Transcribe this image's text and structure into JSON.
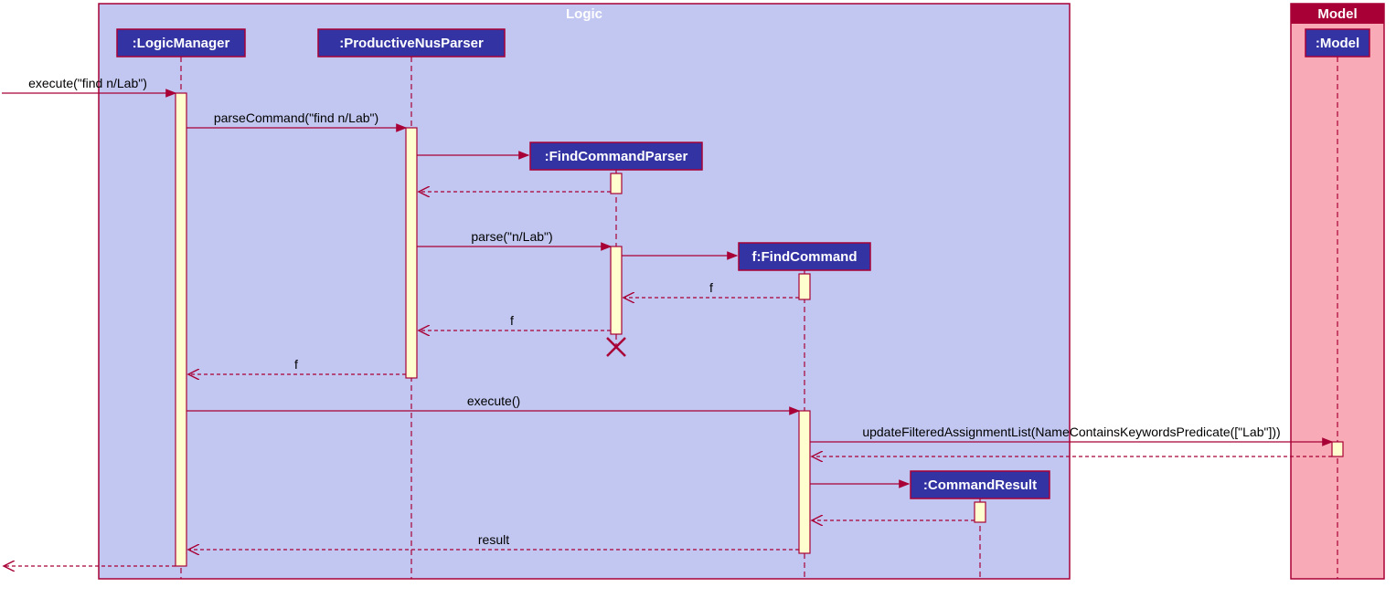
{
  "boxes": {
    "logic": {
      "title": "Logic",
      "fill": "#C2C7F1",
      "title_fill": "#C2C7F1"
    },
    "model": {
      "title": "Model",
      "fill": "#F8AAB6",
      "title_fill": "#A80036"
    }
  },
  "participants": {
    "logic_manager": ":LogicManager",
    "parser": ":ProductiveNusParser",
    "find_parser": ":FindCommandParser",
    "find_cmd": "f:FindCommand",
    "cmd_result": ":CommandResult",
    "model": ":Model"
  },
  "messages": {
    "m1": "execute(\"find n/Lab\")",
    "m2": "parseCommand(\"find n/Lab\")",
    "m3": "parse(\"n/Lab\")",
    "m4": "f",
    "m5": "f",
    "m6": "f",
    "m7": "execute()",
    "m8": "updateFilteredAssignmentList(NameContainsKeywordsPredicate([\"Lab\"]))",
    "m9": "result"
  }
}
